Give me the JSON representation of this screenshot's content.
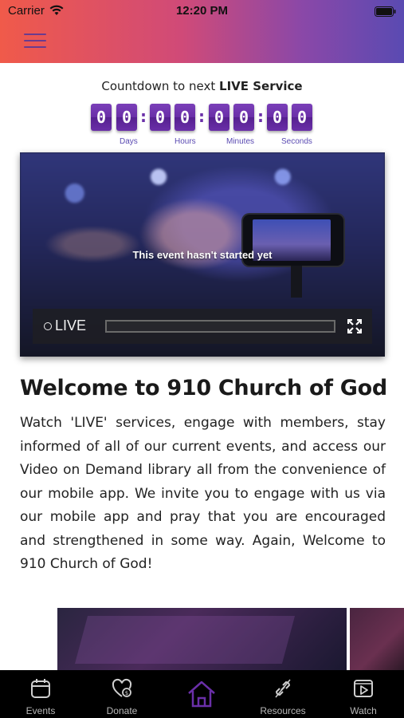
{
  "status_bar": {
    "carrier": "Carrier",
    "time": "12:20 PM"
  },
  "header": {
    "gradient_colors": [
      "#f05a4a",
      "#d04a78",
      "#8a48a8",
      "#5a4ab2"
    ],
    "menu_icon": "hamburger-icon"
  },
  "countdown": {
    "title_prefix": "Countdown to next ",
    "title_bold": "LIVE Service",
    "digits": [
      "0",
      "0",
      "0",
      "0",
      "0",
      "0",
      "0",
      "0"
    ],
    "units": [
      "Days",
      "Hours",
      "Minutes",
      "Seconds"
    ],
    "accent_color": "#6a2fa8"
  },
  "video": {
    "message": "This event hasn't started yet",
    "live_label": "LIVE",
    "fullscreen_icon": "fullscreen-icon"
  },
  "welcome": {
    "title": "Welcome to 910 Church of God",
    "body": "Watch 'LIVE' services, engage with members, stay informed of all of our current events, and access our Video on Demand library all from the convenience of our mobile app. We invite you to engage with us via our mobile app and pray that you are encouraged and strengthened in some way. Again, Welcome to 910 Church of God!"
  },
  "tabs": [
    {
      "label": "Events",
      "icon": "calendar-icon"
    },
    {
      "label": "Donate",
      "icon": "heart-dollar-icon"
    },
    {
      "label": "",
      "icon": "home-icon",
      "active": true
    },
    {
      "label": "Resources",
      "icon": "link-icon"
    },
    {
      "label": "Watch",
      "icon": "play-icon"
    }
  ]
}
